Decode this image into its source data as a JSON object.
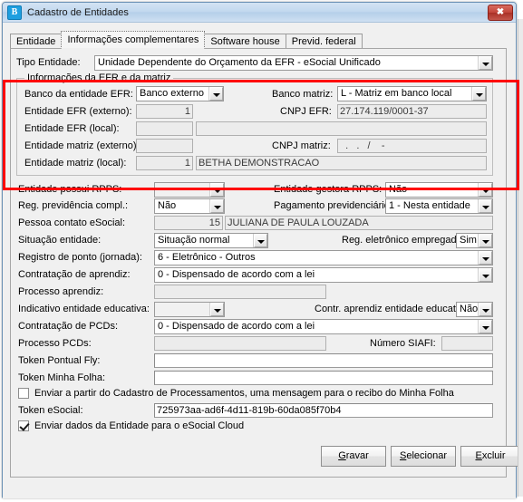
{
  "window": {
    "title": "Cadastro de Entidades",
    "icon": "B",
    "close_label": "✖"
  },
  "tabs": [
    {
      "label": "Entidade",
      "active": false
    },
    {
      "label": "Informações complementares",
      "active": true
    },
    {
      "label": "Software house",
      "active": false
    },
    {
      "label": "Previd. federal",
      "active": false
    }
  ],
  "form": {
    "tipo_entidade": {
      "label": "Tipo Entidade:",
      "value": "Unidade Dependente do Orçamento da EFR - eSocial Unificado"
    },
    "efr_group": {
      "title": "Informações da EFR e da matriz",
      "banco_entidade_efr": {
        "label": "Banco da entidade EFR:",
        "value": "Banco externo"
      },
      "banco_matriz": {
        "label": "Banco matriz:",
        "value": "L - Matriz em banco local"
      },
      "entidade_efr_externo": {
        "label": "Entidade EFR (externo):",
        "value": "1"
      },
      "cnpj_efr": {
        "label": "CNPJ EFR:",
        "value": "27.174.119/0001-37"
      },
      "entidade_efr_local": {
        "label": "Entidade EFR (local):",
        "value": "",
        "desc": ""
      },
      "entidade_matriz_externo": {
        "label": "Entidade matriz (externo):",
        "value": ""
      },
      "cnpj_matriz": {
        "label": "CNPJ matriz:",
        "value": "  .   .   /    -"
      },
      "entidade_matriz_local": {
        "label": "Entidade matriz (local):",
        "value": "1",
        "desc": "BETHA DEMONSTRACAO"
      }
    },
    "entidade_possui_rpps": {
      "label": "Entidade possui RPPS:",
      "value": ""
    },
    "entidade_gestora_rpps": {
      "label": "Entidade gestora RPPS:",
      "value": "Não"
    },
    "reg_previdencia_compl": {
      "label": "Reg. previdência compl.:",
      "value": "Não"
    },
    "pagamento_previdenciario": {
      "label": "Pagamento previdenciário:",
      "value": "1 - Nesta entidade"
    },
    "pessoa_contato_esocial": {
      "label": "Pessoa contato eSocial:",
      "value": "15",
      "desc": "JULIANA DE PAULA LOUZADA"
    },
    "situacao_entidade": {
      "label": "Situação entidade:",
      "value": "Situação normal"
    },
    "reg_eletronico_empregados": {
      "label": "Reg. eletrônico empregados:",
      "value": "Sim"
    },
    "registro_ponto": {
      "label": "Registro de ponto (jornada):",
      "value": "6 - Eletrônico - Outros"
    },
    "contratacao_aprendiz": {
      "label": "Contratação de aprendiz:",
      "value": "0 - Dispensado de acordo com a lei"
    },
    "processo_aprendiz": {
      "label": "Processo aprendiz:",
      "value": ""
    },
    "indicativo_entidade_educativa": {
      "label": "Indicativo entidade educativa:",
      "value": ""
    },
    "contr_aprendiz_entidade_educativa": {
      "label": "Contr. aprendiz entidade educativa:",
      "value": "Não"
    },
    "contratacao_pcds": {
      "label": "Contratação de PCDs:",
      "value": "0 - Dispensado de acordo com a lei"
    },
    "processo_pcds": {
      "label": "Processo PCDs:",
      "value": ""
    },
    "numero_siafi": {
      "label": "Número SIAFI:",
      "value": ""
    },
    "token_pontual_fly": {
      "label": "Token Pontual Fly:",
      "value": ""
    },
    "token_minha_folha": {
      "label": "Token Minha Folha:",
      "value": ""
    },
    "chk_enviar_cadastro": {
      "label": "Enviar a partir do Cadastro de Processamentos, uma mensagem para o recibo do Minha Folha",
      "checked": false
    },
    "token_esocial": {
      "label": "Token eSocial:",
      "value": "725973aa-ad6f-4d11-819b-60da085f70b4"
    },
    "chk_enviar_esocial_cloud": {
      "label": "Enviar dados da Entidade para o eSocial Cloud",
      "checked": true
    }
  },
  "buttons": {
    "gravar": {
      "accel": "G",
      "rest": "ravar"
    },
    "selecionar": {
      "accel": "S",
      "rest": "elecionar"
    },
    "excluir": {
      "accel": "E",
      "rest": "xcluir"
    }
  },
  "colors": {
    "annotation": "#ff0000",
    "titlebar": "#c3d9ef",
    "close": "#c2453a",
    "accent": "#1e9fe0"
  }
}
